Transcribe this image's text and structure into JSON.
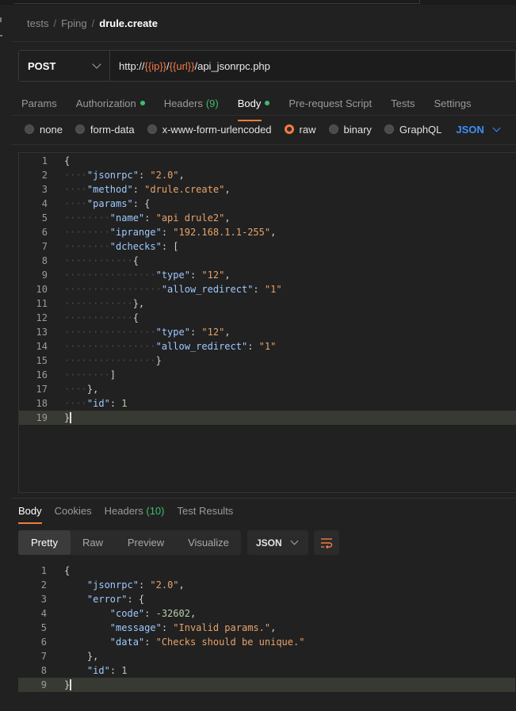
{
  "breadcrumb": {
    "collection": "tests",
    "folder": "Fping",
    "request": "drule.create",
    "separator": "/"
  },
  "request": {
    "method": "POST",
    "url_prefix": "http://",
    "url_var1": "{{ip}}",
    "url_mid": "/",
    "url_var2": "{{url}}",
    "url_suffix": "/api_jsonrpc.php"
  },
  "request_tabs": [
    {
      "label": "Params"
    },
    {
      "label": "Authorization"
    },
    {
      "label": "Headers",
      "count": "(9)"
    },
    {
      "label": "Body"
    },
    {
      "label": "Pre-request Script"
    },
    {
      "label": "Tests"
    },
    {
      "label": "Settings"
    }
  ],
  "body_types": {
    "none": "none",
    "form_data": "form-data",
    "urlencoded": "x-www-form-urlencoded",
    "raw": "raw",
    "binary": "binary",
    "graphql": "GraphQL",
    "language": "JSON"
  },
  "request_body": {
    "lines": [
      "1",
      "2",
      "3",
      "4",
      "5",
      "6",
      "7",
      "8",
      "9",
      "10",
      "11",
      "12",
      "13",
      "14",
      "15",
      "16",
      "17",
      "18",
      "19"
    ],
    "jsonrpc_key": "\"jsonrpc\"",
    "jsonrpc_val": "\"2.0\"",
    "method_key": "\"method\"",
    "method_val": "\"drule.create\"",
    "params_key": "\"params\"",
    "name_key": "\"name\"",
    "name_val": "\"api drule2\"",
    "iprange_key": "\"iprange\"",
    "iprange_val": "\"192.168.1.1-255\"",
    "dchecks_key": "\"dchecks\"",
    "type_key": "\"type\"",
    "type_val": "\"12\"",
    "redirect_key": "\"allow_redirect\"",
    "redirect_val": "\"1\"",
    "id_key": "\"id\"",
    "id_val": "1"
  },
  "response_tabs": [
    {
      "label": "Body"
    },
    {
      "label": "Cookies"
    },
    {
      "label": "Headers",
      "count": "(10)"
    },
    {
      "label": "Test Results"
    }
  ],
  "view_modes": [
    "Pretty",
    "Raw",
    "Preview",
    "Visualize"
  ],
  "response_format": "JSON",
  "response_body": {
    "lines": [
      "1",
      "2",
      "3",
      "4",
      "5",
      "6",
      "7",
      "8",
      "9"
    ],
    "jsonrpc_key": "\"jsonrpc\"",
    "jsonrpc_val": "\"2.0\"",
    "error_key": "\"error\"",
    "code_key": "\"code\"",
    "code_val": "-32602",
    "message_key": "\"message\"",
    "message_val": "\"Invalid params.\"",
    "data_key": "\"data\"",
    "data_val": "\"Checks should be unique.\"",
    "id_key": "\"id\"",
    "id_val": "1"
  },
  "colors": {
    "accent": "#f37b3f",
    "green": "#3bbf6a",
    "blue": "#3d8ff5",
    "var": "#f07c4a"
  }
}
